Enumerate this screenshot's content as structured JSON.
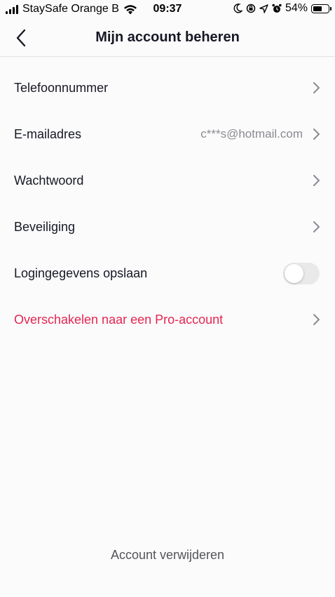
{
  "status_bar": {
    "carrier": "StaySafe Orange B",
    "time": "09:37",
    "battery_percent": "54%",
    "battery_level": 0.54,
    "icons": [
      "signal-icon",
      "wifi-icon",
      "moon-icon",
      "orientation-lock-icon",
      "location-icon",
      "alarm-icon",
      "battery-icon"
    ]
  },
  "header": {
    "title": "Mijn account beheren",
    "back_icon": "chevron-left-icon"
  },
  "settings": [
    {
      "id": "phone",
      "label": "Telefoonnummer",
      "value": ""
    },
    {
      "id": "email",
      "label": "E-mailadres",
      "value": "c***s@hotmail.com"
    },
    {
      "id": "password",
      "label": "Wachtwoord",
      "value": ""
    },
    {
      "id": "security",
      "label": "Beveiliging",
      "value": ""
    },
    {
      "id": "save_login",
      "label": "Logingegevens opslaan",
      "toggle_on": false
    },
    {
      "id": "pro",
      "label": "Overschakelen naar een Pro-account",
      "value": ""
    }
  ],
  "footer": {
    "delete_label": "Account verwijderen"
  },
  "colors": {
    "accent": "#e6264f",
    "text": "#161823",
    "muted": "#8a8b91",
    "background": "#fbfbfc"
  }
}
